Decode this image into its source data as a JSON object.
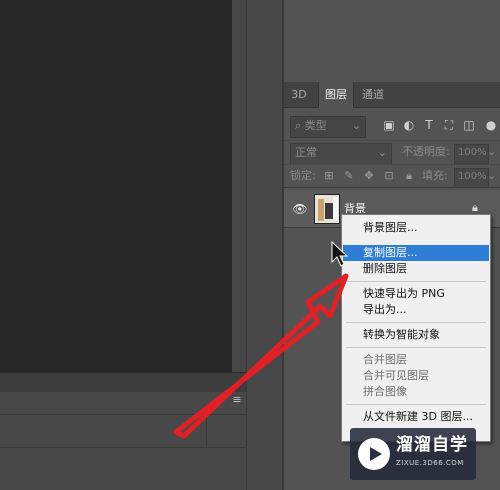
{
  "panel": {
    "tabs": [
      {
        "label": "3D",
        "active": false
      },
      {
        "label": "图层",
        "active": true
      },
      {
        "label": "通道",
        "active": false
      }
    ],
    "filter": {
      "placeholder": "类型"
    },
    "blend_mode": {
      "value": "正常"
    },
    "opacity": {
      "label": "不透明度:",
      "value": "100%"
    },
    "lock": {
      "label": "锁定:"
    },
    "fill": {
      "label": "填充:",
      "value": "100%"
    },
    "layer": {
      "name": "背景",
      "visible": true,
      "locked": true
    }
  },
  "context_menu": {
    "items": [
      {
        "label": "背景图层...",
        "enabled": true,
        "highlighted": false
      },
      {
        "label": "复制图层...",
        "enabled": true,
        "highlighted": true
      },
      {
        "label": "删除图层",
        "enabled": true,
        "highlighted": false
      },
      {
        "label": "快速导出为 PNG",
        "enabled": true,
        "highlighted": false
      },
      {
        "label": "导出为...",
        "enabled": true,
        "highlighted": false
      },
      {
        "label": "转换为智能对象",
        "enabled": true,
        "highlighted": false
      },
      {
        "label": "合并图层",
        "enabled": false,
        "highlighted": false
      },
      {
        "label": "合并可见图层",
        "enabled": false,
        "highlighted": false
      },
      {
        "label": "拼合图像",
        "enabled": false,
        "highlighted": false
      },
      {
        "label": "从文件新建 3D 图层...",
        "enabled": true,
        "highlighted": false
      }
    ]
  },
  "watermark": {
    "title": "溜溜自学",
    "url": "ZIXUE.3D66.COM"
  },
  "colors": {
    "highlight": "#2e7dd7",
    "arrow": "#e02025",
    "canvas": "#282828"
  },
  "icons": [
    "search-icon",
    "image-filter-icon",
    "circle-filter-icon",
    "text-filter-icon",
    "transform-filter-icon",
    "smart-filter-icon",
    "checker-lock-icon",
    "brush-lock-icon",
    "move-lock-icon",
    "artboard-lock-icon",
    "lock-icon",
    "eye-icon",
    "panel-menu-icon",
    "cursor-icon"
  ]
}
